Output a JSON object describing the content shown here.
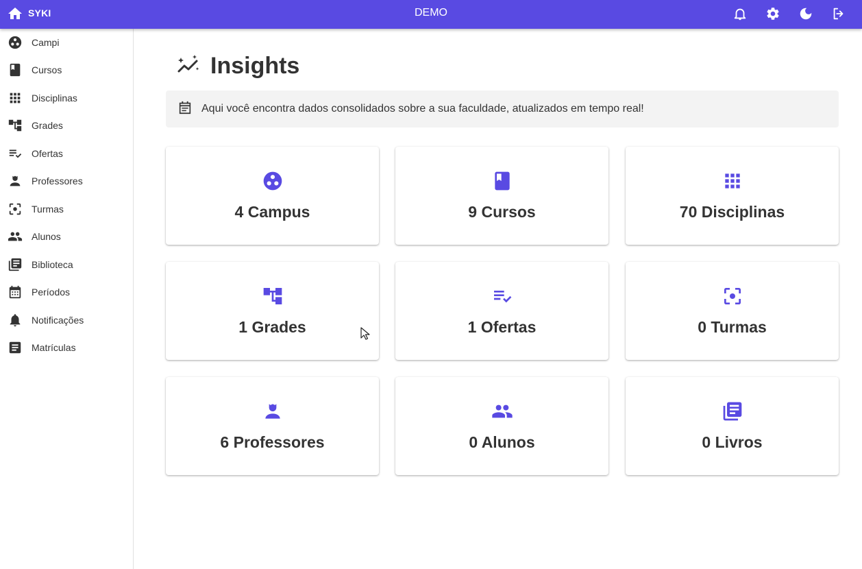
{
  "colors": {
    "primary": "#594ae2",
    "icon_dark": "#333333",
    "banner_bg": "#f3f3f3"
  },
  "appbar": {
    "brand": "SYKI",
    "center_title": "DEMO",
    "home_icon": "home-icon",
    "actions": [
      {
        "icon": "bell-icon"
      },
      {
        "icon": "gear-icon"
      },
      {
        "icon": "moon-icon"
      },
      {
        "icon": "logout-icon"
      }
    ]
  },
  "sidebar": {
    "items": [
      {
        "label": "Campi",
        "icon": "campus-icon"
      },
      {
        "label": "Cursos",
        "icon": "book-icon"
      },
      {
        "label": "Disciplinas",
        "icon": "grid-icon"
      },
      {
        "label": "Grades",
        "icon": "tree-icon"
      },
      {
        "label": "Ofertas",
        "icon": "checklist-icon"
      },
      {
        "label": "Professores",
        "icon": "person-icon"
      },
      {
        "label": "Turmas",
        "icon": "focus-icon"
      },
      {
        "label": "Alunos",
        "icon": "people-icon"
      },
      {
        "label": "Biblioteca",
        "icon": "library-icon"
      },
      {
        "label": "Períodos",
        "icon": "calendar-icon"
      },
      {
        "label": "Notificações",
        "icon": "bell-icon"
      },
      {
        "label": "Matrículas",
        "icon": "article-icon"
      }
    ]
  },
  "main": {
    "title": "Insights",
    "title_icon": "sparkle-chart-icon",
    "banner": {
      "icon": "calendar-note-icon",
      "text": "Aqui você encontra dados consolidados sobre a sua faculdade, atualizados em tempo real!"
    },
    "cards": [
      {
        "value": "4 Campus",
        "icon": "campus-icon"
      },
      {
        "value": "9 Cursos",
        "icon": "book-icon"
      },
      {
        "value": "70 Disciplinas",
        "icon": "grid-icon"
      },
      {
        "value": "1 Grades",
        "icon": "tree-icon"
      },
      {
        "value": "1 Ofertas",
        "icon": "checklist-icon"
      },
      {
        "value": "0 Turmas",
        "icon": "focus-icon"
      },
      {
        "value": "6 Professores",
        "icon": "person-icon"
      },
      {
        "value": "0 Alunos",
        "icon": "people-icon"
      },
      {
        "value": "0 Livros",
        "icon": "library-icon"
      }
    ]
  }
}
